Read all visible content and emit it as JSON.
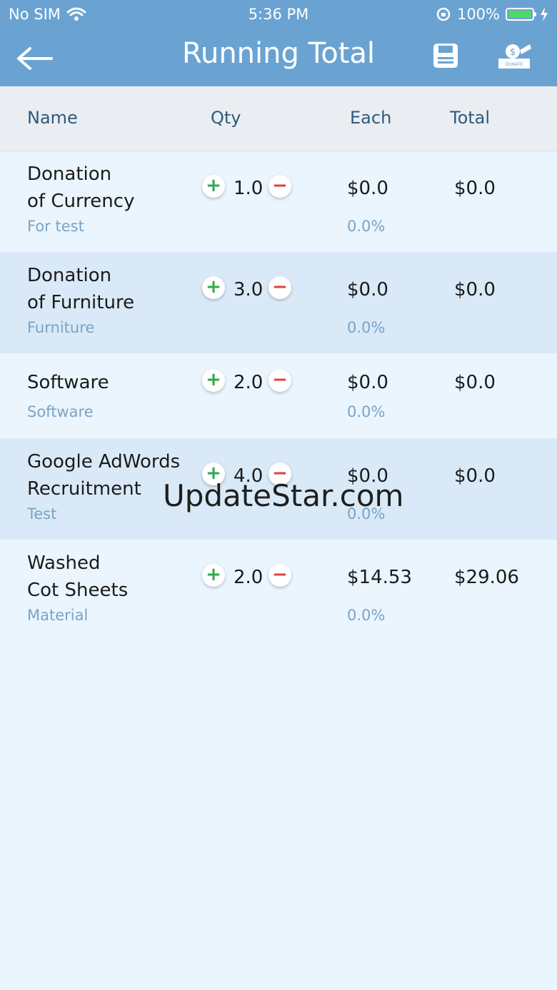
{
  "status": {
    "carrier": "No SIM",
    "time": "5:36 PM",
    "battery": "100%"
  },
  "nav": {
    "title": "Running Total",
    "back_icon": "arrow-left-icon",
    "save_icon": "save-icon",
    "donate_icon": "donate-icon",
    "donate_label": "DONATE"
  },
  "columns": {
    "name": "Name",
    "qty": "Qty",
    "each": "Each",
    "total": "Total"
  },
  "rows": [
    {
      "name": "Donation\nof Currency",
      "category": "For test",
      "qty": "1.0",
      "each": "$0.0",
      "percent": "0.0%",
      "total": "$0.0"
    },
    {
      "name": "Donation\nof Furniture",
      "category": "Furniture",
      "qty": "3.0",
      "each": "$0.0",
      "percent": "0.0%",
      "total": "$0.0"
    },
    {
      "name": "Software",
      "category": "Software",
      "qty": "2.0",
      "each": "$0.0",
      "percent": "0.0%",
      "total": "$0.0"
    },
    {
      "name": "Google AdWords\nRecruitment",
      "category": "Test",
      "qty": "4.0",
      "each": "$0.0",
      "percent": "0.0%",
      "total": "$0.0"
    },
    {
      "name": "Washed\nCot Sheets",
      "category": "Material",
      "qty": "2.0",
      "each": "$14.53",
      "percent": "0.0%",
      "total": "$29.06"
    }
  ],
  "watermark": "UpdateStar.com",
  "colors": {
    "nav": "#6aa3d2",
    "header": "#eaeef2",
    "row_alt": "#d9e9f7",
    "background": "#eaf5fe",
    "plus": "#2eaa4a",
    "minus": "#e0403a",
    "category": "#7aa4c6"
  }
}
